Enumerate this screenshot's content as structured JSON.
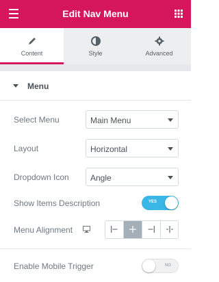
{
  "header": {
    "title": "Edit Nav Menu"
  },
  "tabs": [
    {
      "label": "Content",
      "icon": "pencil-icon",
      "active": true
    },
    {
      "label": "Style",
      "icon": "contrast-icon",
      "active": false
    },
    {
      "label": "Advanced",
      "icon": "gear-icon",
      "active": false
    }
  ],
  "section": {
    "title": "Menu"
  },
  "controls": {
    "select_menu": {
      "label": "Select Menu",
      "value": "Main Menu"
    },
    "layout": {
      "label": "Layout",
      "value": "Horizontal"
    },
    "dropdown_icon": {
      "label": "Dropdown Icon",
      "value": "Angle"
    },
    "show_items_description": {
      "label": "Show Items Description",
      "state": "YES"
    },
    "menu_alignment": {
      "label": "Menu Alignment",
      "options": [
        "align-left",
        "align-center",
        "align-right",
        "justify"
      ],
      "selected": "align-center"
    },
    "enable_mobile_trigger": {
      "label": "Enable Mobile Trigger",
      "state": "NO"
    }
  },
  "colors": {
    "brand": "#d5155c",
    "toggle_on": "#39b5e6",
    "active_align": "#a4afb7"
  }
}
